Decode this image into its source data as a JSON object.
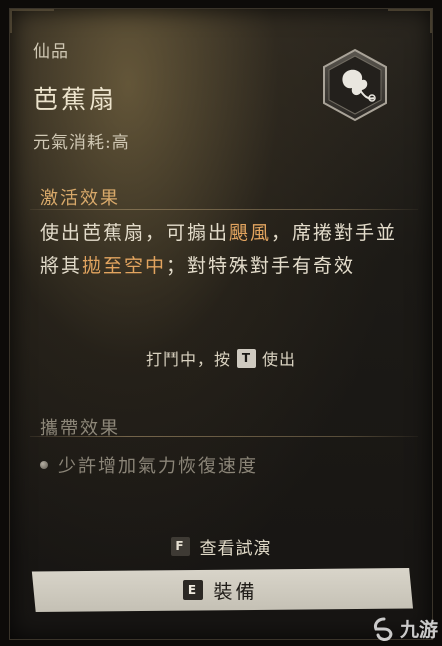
{
  "item": {
    "rarity": "仙品",
    "name": "芭蕉扇",
    "cost": "元氣消耗:高",
    "emblem_icon": "banana-fan-emblem-icon"
  },
  "activation": {
    "title": "激活效果",
    "desc": [
      {
        "text": "使出芭蕉扇，可搧出",
        "hl": false
      },
      {
        "text": "颶風",
        "hl": true
      },
      {
        "text": "，席捲對手並將其",
        "hl": false
      },
      {
        "text": "拋至空中",
        "hl": true
      },
      {
        "text": "；對特殊對手有奇效",
        "hl": false
      }
    ],
    "hint_prefix": "打鬥中，按",
    "hint_key": "T",
    "hint_suffix": "使出"
  },
  "carry": {
    "title": "攜帶效果",
    "items": [
      "少許增加氣力恢復速度"
    ]
  },
  "preview": {
    "key": "F",
    "label": "查看試演"
  },
  "equip": {
    "key": "E",
    "label": "裝備"
  },
  "watermark": {
    "text": "九游"
  },
  "colors": {
    "highlight": "#e2a45f",
    "section_title": "#d8a96a",
    "text": "#e3dccb",
    "dim": "#8d8779"
  }
}
